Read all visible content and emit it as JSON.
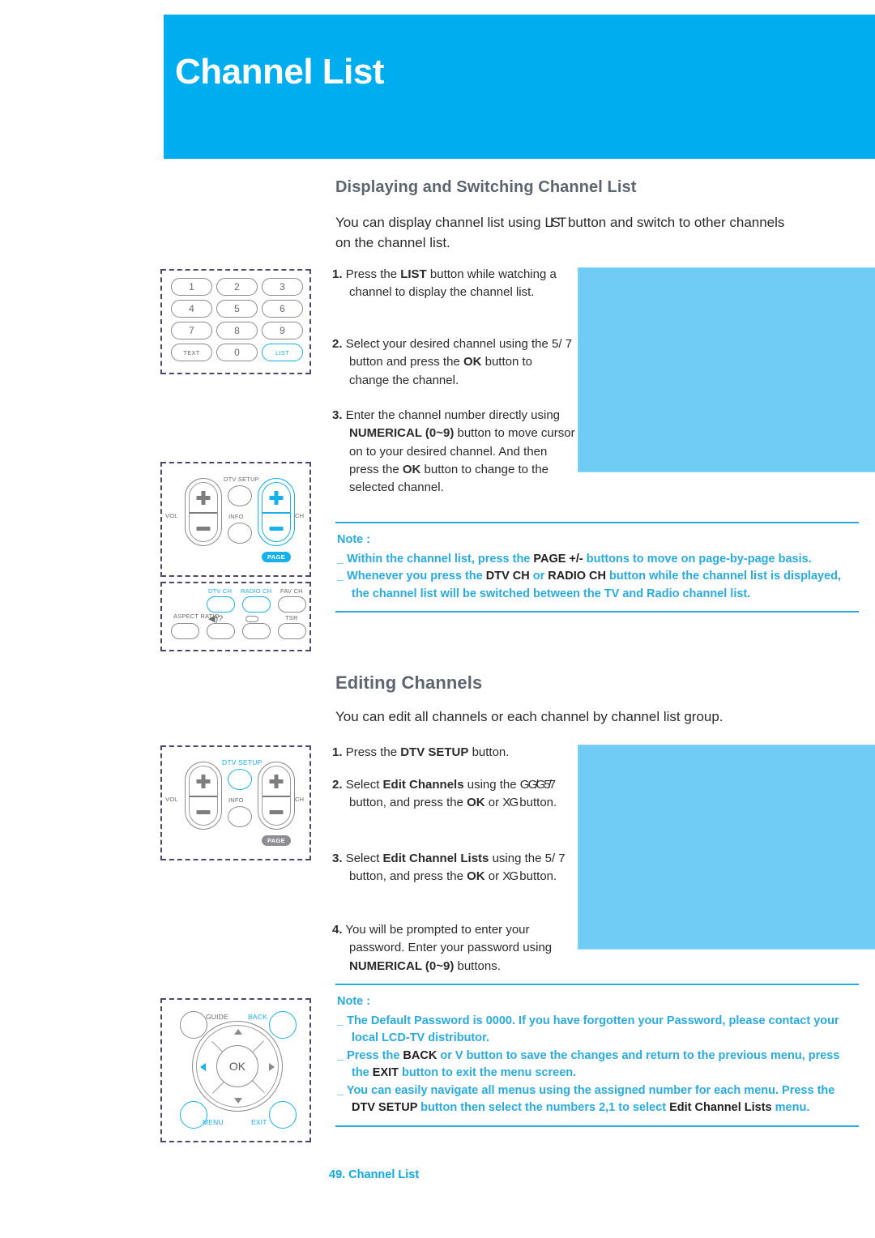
{
  "header": {
    "title": "Channel List",
    "band_color": "#00ADEE"
  },
  "sections": {
    "one": {
      "heading": "Displaying and Switching Channel List",
      "intro_a": "You can display channel list using ",
      "intro_b": "LIST",
      "intro_c": " button and switch to other channels",
      "intro_d": "on the channel list.",
      "steps": [
        {
          "num": "1.",
          "text_a": "Press the ",
          "bold_a": "LIST",
          "text_b": " button while watching a channel to display the channel list."
        },
        {
          "num": "2.",
          "text_a": "Select your desired channel using the ",
          "bold_a": "5/ 7",
          "text_b": " button and press the ",
          "bold_b": "OK",
          "text_c": " button to change the channel."
        },
        {
          "num": "3.",
          "text_a": "Enter the channel number directly using ",
          "bold_a": "NUMERICAL (0~9)",
          "text_b": " button to move cursor on to your desired channel. And then press the ",
          "bold_b": "OK",
          "text_c": " button to change to the selected channel."
        }
      ],
      "note": {
        "title": "Note :",
        "items": [
          {
            "pre": "Within the channel list, press the ",
            "key": "PAGE +/-",
            "post": " buttons to move on page-by-page basis."
          },
          {
            "pre": "Whenever you press the ",
            "key": "DTV CH",
            "mid": " or ",
            "key2": "RADIO CH",
            "post": " button while the channel list is displayed, the channel list will be switched between the TV and Radio channel list."
          }
        ]
      }
    },
    "two": {
      "heading": "Editing Channels",
      "intro": "You can edit all channels or each channel by channel list group.",
      "steps": [
        {
          "num": "1.",
          "text_a": "Press the ",
          "bold_a": "DTV SETUP",
          "text_b": " button."
        },
        {
          "num": "2.",
          "text_a": "Select ",
          "bold_a": "Edit Channels",
          "text_b": " using the ",
          "glyph": "G G/G 5/7",
          "text_c": " button, and press the ",
          "bold_b": "OK",
          "text_d": " or ",
          "glyph2": "X G",
          "text_e": " button."
        },
        {
          "num": "3.",
          "text_a": "Select ",
          "bold_a": "Edit Channel Lists",
          "text_b": " using the ",
          "glyph": "5/ 7",
          "text_c": " button, and press the ",
          "bold_b": "OK",
          "text_d": " or ",
          "glyph2": "X G",
          "text_e": " button."
        },
        {
          "num": "4.",
          "text_a": "You will be prompted to enter your password. Enter your password using ",
          "bold_a": "NUMERICAL (0~9)",
          "text_b": " buttons."
        }
      ],
      "note": {
        "title": "Note :",
        "items": [
          {
            "pre": "The Default Password is 0000. If you have forgotten your Password, please contact your local LCD-TV distributor."
          },
          {
            "pre": "Press the ",
            "key": "BACK",
            "mid": " or ",
            "key2": "V",
            "post": " button to save the changes and return to the previous menu, press the ",
            "key3": "EXIT",
            "post2": " button to exit the menu screen."
          },
          {
            "pre": "You can easily navigate all menus using the assigned number for each menu. Press the ",
            "key": "DTV SETUP",
            "post": " button then select the numbers 2,1 to select ",
            "key2": "Edit Channel Lists",
            "post2": " menu."
          }
        ]
      }
    }
  },
  "remotes": {
    "keypad": {
      "rows": [
        [
          "1",
          "2",
          "3"
        ],
        [
          "4",
          "5",
          "6"
        ],
        [
          "7",
          "8",
          "9"
        ],
        [
          "TEXT",
          "0",
          "LIST"
        ]
      ],
      "highlighted": "LIST"
    },
    "volch1": {
      "vol_label": "VOL",
      "ch_label": "CH",
      "dtv_setup_label": "DTV SETUP",
      "info_label": "INFO",
      "page_label": "PAGE",
      "highlighted": "CH"
    },
    "chsel": {
      "dtv_ch_label": "DTV CH",
      "radio_ch_label": "RADIO CH",
      "fav_ch_label": "FAV CH",
      "aspect_ratio_label": "ASPECT RATIO",
      "tsr_label": "TSR",
      "sound_icon": "speaker-question"
    },
    "volch2": {
      "vol_label": "VOL",
      "ch_label": "CH",
      "dtv_setup_label": "DTV SETUP",
      "info_label": "INFO",
      "page_label": "PAGE",
      "highlighted": "DTV SETUP"
    },
    "dpad": {
      "guide_label": "GUIDE",
      "back_label": "BACK",
      "menu_label": "MENU",
      "exit_label": "EXIT",
      "ok_label": "OK"
    }
  },
  "footer": {
    "text": "49. Channel List"
  },
  "colors": {
    "brand_blue": "#00ADEE",
    "note_blue": "#29ABE2",
    "placeholder_blue": "#6ECCF5",
    "heading_gray": "#5b6670"
  }
}
